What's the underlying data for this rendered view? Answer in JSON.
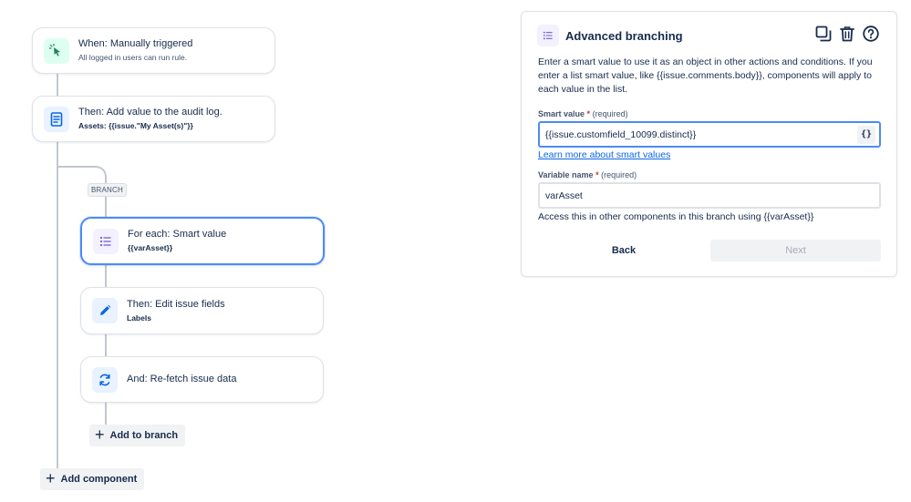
{
  "canvas": {
    "trigger": {
      "title": "When: Manually triggered",
      "subtitle": "All logged in users can run rule."
    },
    "audit_log": {
      "title": "Then: Add value to the audit log.",
      "subtitle": "Assets: {{issue.\"My Asset(s)\"}}"
    },
    "branch_label": "BRANCH",
    "for_each": {
      "title": "For each: Smart value",
      "subtitle": "{{varAsset}}"
    },
    "edit_fields": {
      "title": "Then: Edit issue fields",
      "subtitle": "Labels"
    },
    "refetch": {
      "title": "And: Re-fetch issue data"
    },
    "add_to_branch": "Add to branch",
    "add_component": "Add component"
  },
  "panel": {
    "title": "Advanced branching",
    "description": "Enter a smart value to use it as an object in other actions and conditions. If you enter a list smart value, like {{issue.comments.body}}, components will apply to each value in the list.",
    "smart_value": {
      "label": "Smart value",
      "required_mark": "*",
      "required_text": "(required)",
      "value": "{{issue.customfield_10099.distinct}}",
      "braces": "{}"
    },
    "learn_more": "Learn more about smart values",
    "variable_name": {
      "label": "Variable name",
      "required_mark": "*",
      "required_text": "(required)",
      "value": "varAsset"
    },
    "helper": "Access this in other components in this branch using {{varAsset}}",
    "back": "Back",
    "next": "Next"
  },
  "colors": {
    "accent": "#4c8bf5",
    "link": "#0c66e4",
    "text": "#172b4d",
    "connector": "#c1c7d0"
  },
  "icons": {
    "trigger": "cursor-click-icon",
    "audit_log": "document-icon",
    "for_each": "list-icon",
    "edit_fields": "pencil-icon",
    "refetch": "refresh-icon",
    "duplicate": "duplicate-icon",
    "delete": "trash-icon",
    "help": "help-icon"
  }
}
